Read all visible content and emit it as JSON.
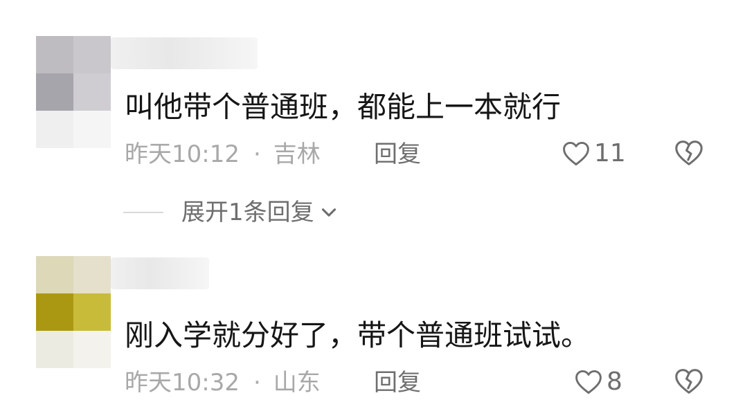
{
  "comments": [
    {
      "text": "叫他带个普通班，都能上一本就行",
      "time": "昨天10:12",
      "separator": "·",
      "location": "吉林",
      "reply_label": "回复",
      "like_count": "11",
      "expand_replies_label": "展开1条回复",
      "avatar_colors": [
        "#bfbcc1",
        "#c9c7cb",
        "#a7a5ac",
        "#cfcdd2",
        "#efefef",
        "#f5f5f5"
      ]
    },
    {
      "text": "刚入学就分好了，带个普通班试试。",
      "time": "昨天10:32",
      "separator": "·",
      "location": "山东",
      "reply_label": "回复",
      "like_count": "8",
      "avatar_colors": [
        "#dcd8b8",
        "#e4e0cc",
        "#ab9812",
        "#c9bb3a",
        "#ecebe1",
        "#f3f2ec"
      ]
    }
  ],
  "colors": {
    "text_primary": "#161616",
    "text_meta": "#a8a8a8",
    "text_action": "#6e6e6e",
    "icon": "#6e6e6e"
  }
}
